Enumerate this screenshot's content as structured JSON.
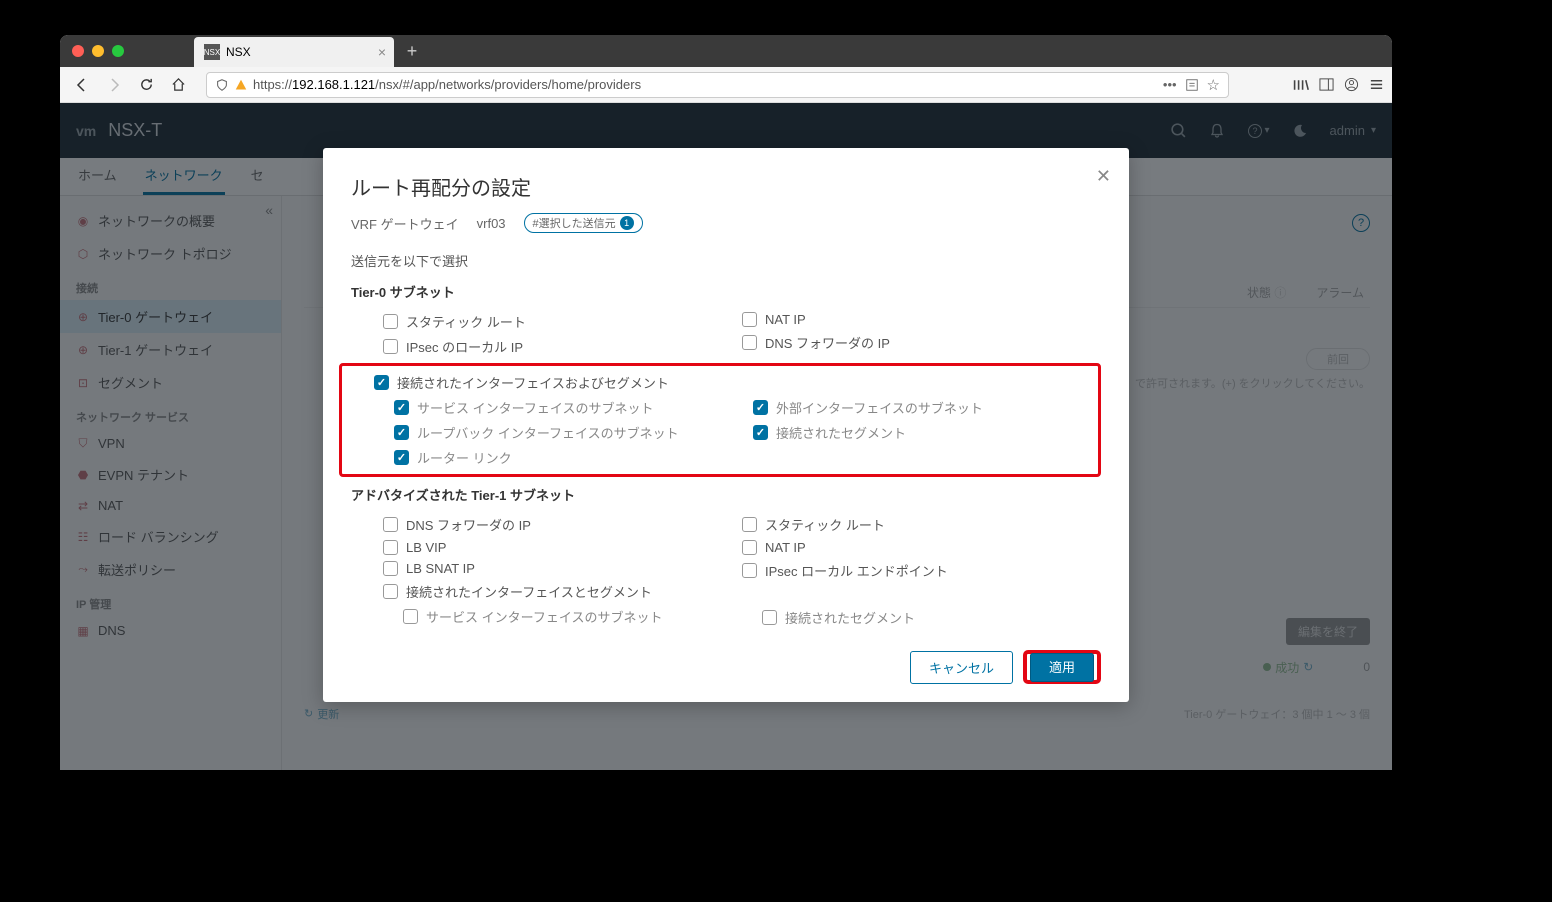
{
  "browser": {
    "tab_title": "NSX",
    "url_display_prefix": "https://",
    "url_host": "192.168.1.121",
    "url_path": "/nsx/#/app/networks/providers/home/providers"
  },
  "header": {
    "logo": "vm",
    "product": "NSX-T",
    "user": "admin"
  },
  "main_tabs": {
    "home": "ホーム",
    "network": "ネットワーク",
    "security_prefix": "セ"
  },
  "sidebar": {
    "overview": "ネットワークの概要",
    "topology": "ネットワーク トポロジ",
    "conn_heading": "接続",
    "tier0": "Tier-0 ゲートウェイ",
    "tier1": "Tier-1 ゲートウェイ",
    "segment": "セグメント",
    "svc_heading": "ネットワーク サービス",
    "vpn": "VPN",
    "evpn": "EVPN テナント",
    "nat": "NAT",
    "lb": "ロード バランシング",
    "fwd": "転送ポリシー",
    "ip_heading": "IP 管理",
    "dns": "DNS"
  },
  "bg": {
    "col_status": "状態",
    "col_alarm": "アラーム",
    "prev": "前回",
    "hint": "で許可されます。(+) をクリックしてください。",
    "finish": "編集を終了",
    "success": "成功",
    "count": "0",
    "refresh": "更新",
    "pager": "Tier-0 ゲートウェイ：3 個中 1 ～ 3 個"
  },
  "modal": {
    "title": "ルート再配分の設定",
    "gateway_label": "VRF ゲートウェイ",
    "gateway_name": "vrf03",
    "badge_text": "#選択した送信元",
    "badge_count": "1",
    "select_desc": "送信元を以下で選択",
    "tier0_h": "Tier-0 サブネット",
    "static_route": "スタティック ルート",
    "nat_ip": "NAT IP",
    "ipsec_local": "IPsec のローカル IP",
    "dns_fwd_ip": "DNS フォワーダの IP",
    "connected_if_seg": "接続されたインターフェイスおよびセグメント",
    "svc_if_subnet": "サービス インターフェイスのサブネット",
    "ext_if_subnet": "外部インターフェイスのサブネット",
    "loopback_subnet": "ループバック インターフェイスのサブネット",
    "connected_seg": "接続されたセグメント",
    "router_link": "ルーター リンク",
    "tier1_h": "アドバタイズされた Tier-1 サブネット",
    "t1_dns_fwd": "DNS フォワーダの IP",
    "t1_static": "スタティック ルート",
    "t1_lb_vip": "LB VIP",
    "t1_nat": "NAT IP",
    "t1_lb_snat": "LB SNAT IP",
    "t1_ipsec": "IPsec ローカル エンドポイント",
    "t1_conn_if_seg": "接続されたインターフェイスとセグメント",
    "t1_svc_if": "サービス インターフェイスのサブネット",
    "t1_conn_seg": "接続されたセグメント",
    "cancel": "キャンセル",
    "apply": "適用"
  }
}
